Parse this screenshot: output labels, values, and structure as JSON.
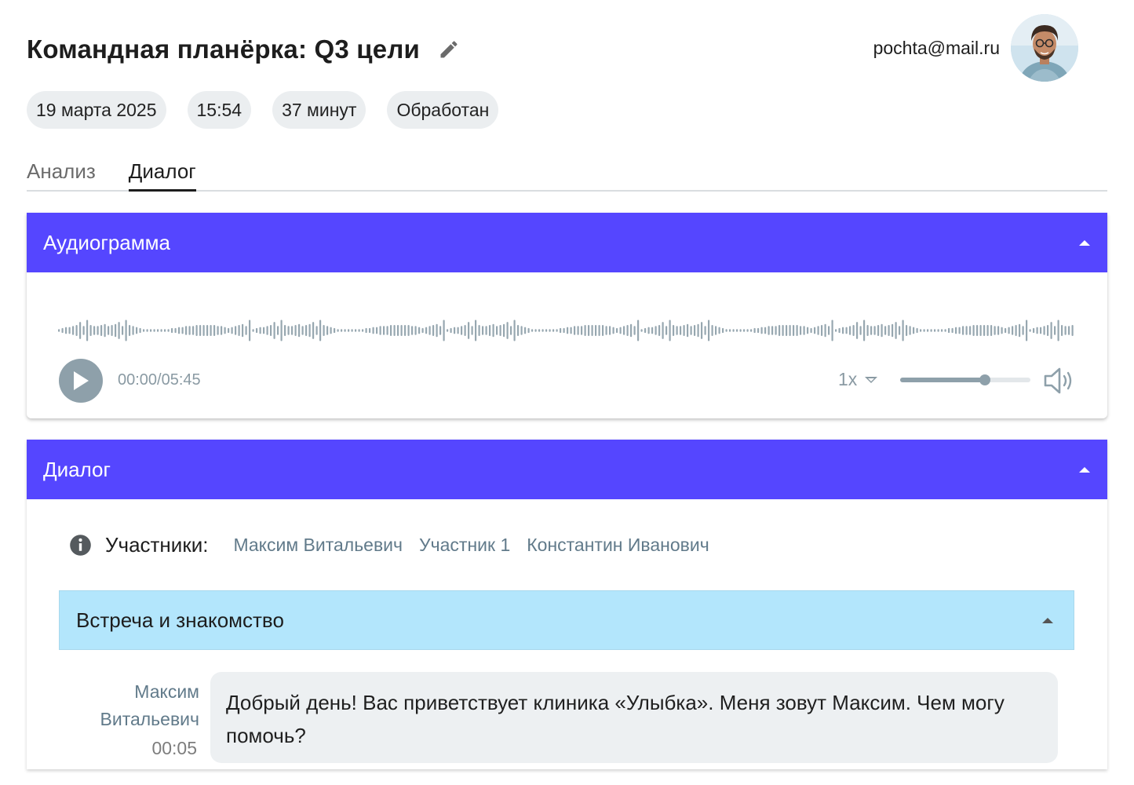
{
  "header": {
    "title": "Командная планёрка: Q3 цели",
    "user_email": "pochta@mail.ru"
  },
  "chips": [
    "19 марта 2025",
    "15:54",
    "37 минут",
    "Обработан"
  ],
  "tabs": [
    {
      "label": "Анализ",
      "active": false
    },
    {
      "label": "Диалог",
      "active": true
    }
  ],
  "audio_panel": {
    "title": "Аудиограмма",
    "time": "00:00/05:45",
    "speed": "1x",
    "volume": 0.65
  },
  "dialog_panel": {
    "title": "Диалог",
    "participants_label": "Участники:",
    "participants": [
      "Максим Витальевич",
      "Участник 1",
      "Константин Иванович"
    ],
    "section_title": "Встреча и знакомство",
    "messages": [
      {
        "speaker_first": "Максим",
        "speaker_last": "Витальевич",
        "time": "00:05",
        "text": "Добрый день! Вас приветствует клиника «Улыбка». Меня зовут Максим. Чем могу помочь?"
      }
    ]
  },
  "colors": {
    "accent": "#5546ff",
    "section_bg": "#b3e6fc",
    "muted": "#8ea0aa",
    "link": "#617a8a"
  }
}
